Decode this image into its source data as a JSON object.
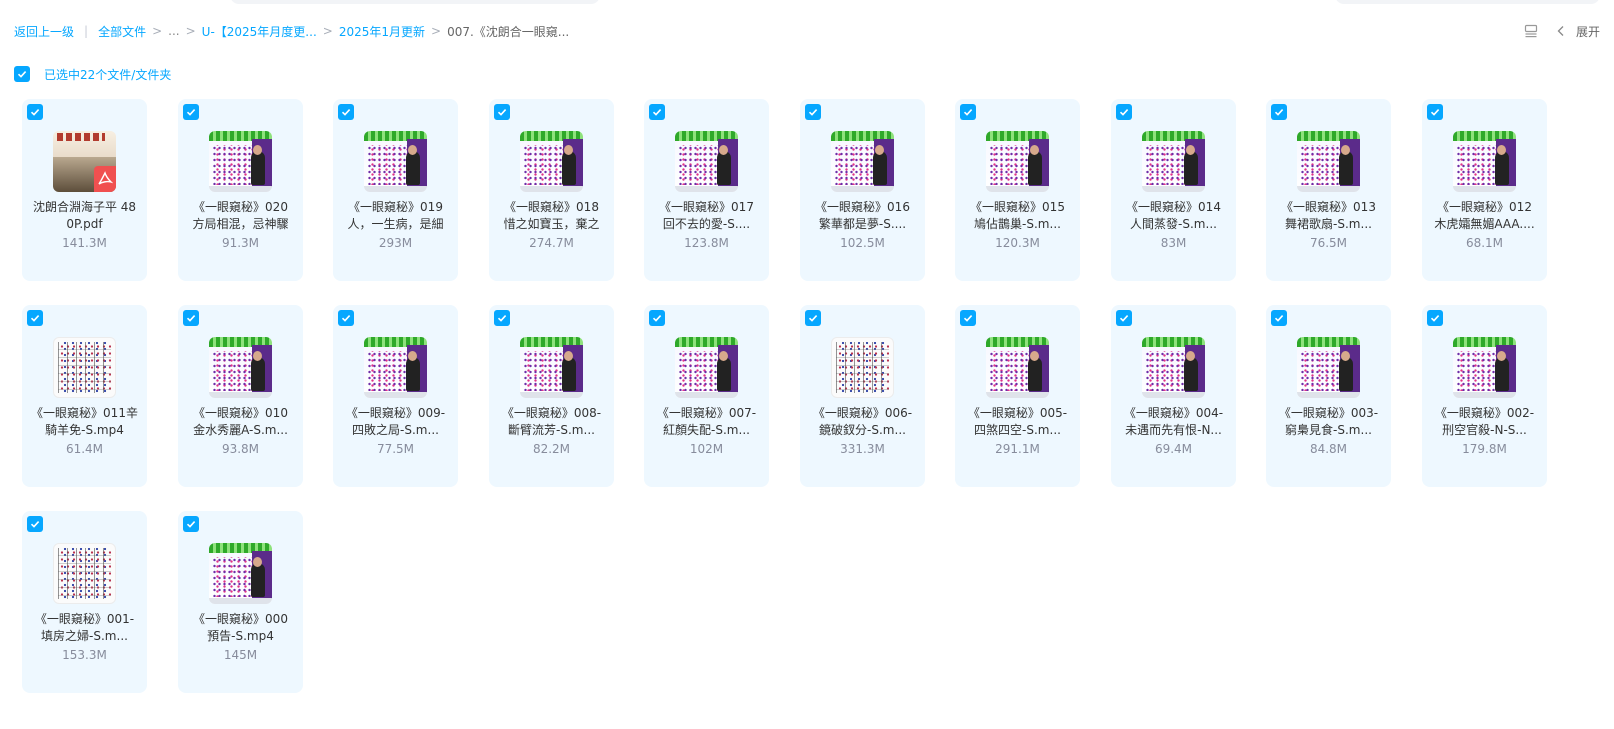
{
  "breadcrumb": {
    "back": "返回上一级",
    "all_files": "全部文件",
    "ellipsis": "...",
    "level1": "U-【2025年月度更...",
    "level2": "2025年1月更新",
    "current": "007.《沈朗合一眼窺..."
  },
  "toolbar": {
    "expand_label": "展开",
    "icons": [
      "list-view-icon",
      "chevron-left-icon"
    ]
  },
  "selection": {
    "text": "已选中22个文件/文件夹"
  },
  "colors": {
    "accent": "#06a7ff",
    "card_bg": "#eef8ff",
    "size_text": "#878c9c"
  },
  "files": [
    {
      "line1": "沈朗合淵海子平 48",
      "line2": "0P.pdf",
      "size": "141.3M",
      "thumb": "pdf"
    },
    {
      "line1": "《一眼窺秘》020",
      "line2": "方局相混，忌神驟",
      "size": "91.3M",
      "thumb": "video"
    },
    {
      "line1": "《一眼窺秘》019",
      "line2": "人，一生病，是細",
      "size": "293M",
      "thumb": "video"
    },
    {
      "line1": "《一眼窺秘》018",
      "line2": "惜之如寶玉，棄之",
      "size": "274.7M",
      "thumb": "video"
    },
    {
      "line1": "《一眼窺秘》017",
      "line2": "回不去的愛-S....",
      "size": "123.8M",
      "thumb": "video"
    },
    {
      "line1": "《一眼窺秘》016",
      "line2": "繁華都是夢-S....",
      "size": "102.5M",
      "thumb": "video"
    },
    {
      "line1": "《一眼窺秘》015",
      "line2": "鳩佔鵲巢-S.m...",
      "size": "120.3M",
      "thumb": "video"
    },
    {
      "line1": "《一眼窺秘》014",
      "line2": "人間蒸發-S.m...",
      "size": "83M",
      "thumb": "video"
    },
    {
      "line1": "《一眼窺秘》013",
      "line2": "舞裙歌扇-S.m...",
      "size": "76.5M",
      "thumb": "video"
    },
    {
      "line1": "《一眼窺秘》012",
      "line2": "木虎孀無媚AAA....",
      "size": "68.1M",
      "thumb": "video"
    },
    {
      "line1": "《一眼窺秘》011辛",
      "line2": "騎羊免-S.mp4",
      "size": "61.4M",
      "thumb": "chart"
    },
    {
      "line1": "《一眼窺秘》010",
      "line2": "金水秀麗A-S.m...",
      "size": "93.8M",
      "thumb": "video"
    },
    {
      "line1": "《一眼窺秘》009-",
      "line2": "四敗之局-S.m...",
      "size": "77.5M",
      "thumb": "video"
    },
    {
      "line1": "《一眼窺秘》008-",
      "line2": "斷臂流芳-S.m...",
      "size": "82.2M",
      "thumb": "video"
    },
    {
      "line1": "《一眼窺秘》007-",
      "line2": "紅顏失配-S.m...",
      "size": "102M",
      "thumb": "video"
    },
    {
      "line1": "《一眼窺秘》006-",
      "line2": "鏡破釵分-S.m...",
      "size": "331.3M",
      "thumb": "chart"
    },
    {
      "line1": "《一眼窺秘》005-",
      "line2": "四煞四空-S.m...",
      "size": "291.1M",
      "thumb": "video"
    },
    {
      "line1": "《一眼窺秘》004-",
      "line2": "未遇而先有恨-N...",
      "size": "69.4M",
      "thumb": "video"
    },
    {
      "line1": "《一眼窺秘》003-",
      "line2": "窮梟見食-S.m...",
      "size": "84.8M",
      "thumb": "video"
    },
    {
      "line1": "《一眼窺秘》002-",
      "line2": "刑空官殺-N-S...",
      "size": "179.8M",
      "thumb": "video"
    },
    {
      "line1": "《一眼窺秘》001-",
      "line2": "填房之婦-S.m...",
      "size": "153.3M",
      "thumb": "chart"
    },
    {
      "line1": "《一眼窺秘》000",
      "line2": "預告-S.mp4",
      "size": "145M",
      "thumb": "video"
    }
  ]
}
